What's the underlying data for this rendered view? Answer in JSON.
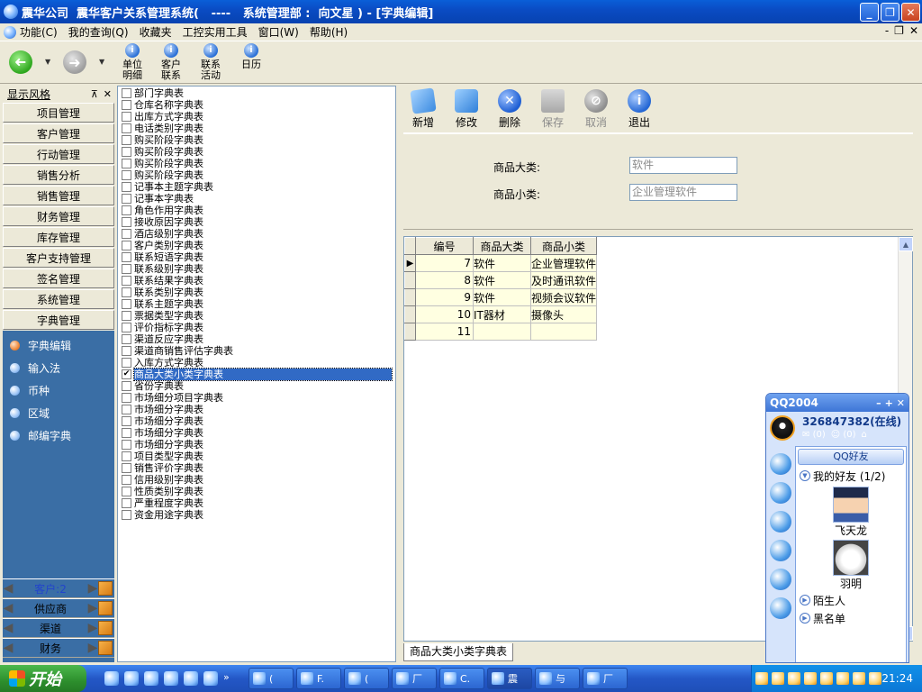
{
  "window": {
    "title": "震华公司  震华客户关系管理系统(   ----   系统管理部 :  向文星 ) - [字典编辑]",
    "minimize": "_",
    "restore": "❐",
    "close": "✕"
  },
  "menu": {
    "items": [
      "功能(C)",
      "我的查询(Q)",
      "收藏夹",
      "工控实用工具",
      "窗口(W)",
      "帮助(H)"
    ],
    "mdi_controls": [
      "-",
      "❐",
      "✕"
    ]
  },
  "toolbar": {
    "back_arrow": "➜",
    "fwd_arrow": "➜",
    "dropdown": "▼",
    "buttons": [
      {
        "label": "单位\n明细",
        "icon": "info-icon"
      },
      {
        "label": "客户\n联系",
        "icon": "info-icon"
      },
      {
        "label": "联系\n活动",
        "icon": "info-icon"
      },
      {
        "label": "日历",
        "icon": "info-icon"
      }
    ],
    "icon_glyph": "i"
  },
  "left_panel": {
    "title": "显示风格",
    "pin": "⊼",
    "close": "✕",
    "modules": [
      "项目管理",
      "客户管理",
      "行动管理",
      "销售分析",
      "销售管理",
      "财务管理",
      "库存管理",
      "客户支持管理",
      "签名管理",
      "系统管理",
      "字典管理"
    ],
    "sub_items": [
      "字典编辑",
      "输入法",
      "币种",
      "区域",
      "邮编字典"
    ],
    "active_sub": 0,
    "bottom": [
      "客户:2",
      "供应商",
      "渠道",
      "财务"
    ],
    "left_arrow": "◀",
    "right_arrow": "▶"
  },
  "dict_list": {
    "items": [
      "部门字典表",
      "仓库名称字典表",
      "出库方式字典表",
      "电话类别字典表",
      "购买阶段字典表",
      "购买阶段字典表",
      "购买阶段字典表",
      "购买阶段字典表",
      "记事本主题字典表",
      "记事本字典表",
      "角色作用字典表",
      "接收原因字典表",
      "酒店级别字典表",
      "客户类别字典表",
      "联系短语字典表",
      "联系级别字典表",
      "联系结果字典表",
      "联系类别字典表",
      "联系主题字典表",
      "票据类型字典表",
      "评价指标字典表",
      "渠道反应字典表",
      "渠道商销售评估字典表",
      "入库方式字典表",
      "商品大类小类字典表",
      "省份字典表",
      "市场细分项目字典表",
      "市场细分字典表",
      "市场细分字典表",
      "市场细分字典表",
      "市场细分字典表",
      "项目类型字典表",
      "销售评价字典表",
      "信用级别字典表",
      "性质类别字典表",
      "严重程度字典表",
      "资金用途字典表"
    ],
    "selected_index": 24,
    "check_mark": "✔"
  },
  "actions": {
    "new": "新增",
    "edit": "修改",
    "delete": "删除",
    "save": "保存",
    "cancel": "取消",
    "exit": "退出",
    "delete_glyph": "✕",
    "cancel_glyph": "⊘",
    "exit_glyph": "i"
  },
  "form": {
    "category_label": "商品大类:",
    "category_value": "软件",
    "subcategory_label": "商品小类:",
    "subcategory_value": "企业管理软件"
  },
  "grid": {
    "columns": [
      "编号",
      "商品大类",
      "商品小类"
    ],
    "current_row_marker": "▶",
    "rows": [
      {
        "id": "7",
        "category": "软件",
        "sub": "企业管理软件"
      },
      {
        "id": "8",
        "category": "软件",
        "sub": "及时通讯软件"
      },
      {
        "id": "9",
        "category": "软件",
        "sub": "视频会议软件"
      },
      {
        "id": "10",
        "category": "IT器材",
        "sub": "摄像头"
      },
      {
        "id": "11",
        "category": "",
        "sub": ""
      }
    ],
    "scroll_up": "▲",
    "scroll_down": "▼"
  },
  "bottom_tab": "商品大类小类字典表",
  "qq": {
    "title": "QQ2004",
    "controls": [
      "–",
      "+",
      "✕"
    ],
    "number": "326847382(在线)",
    "mail": "(0)",
    "contacts": "(0)",
    "friends_tab": "QQ好友",
    "my_friends": "我的好友 (1/2)",
    "friends": [
      "飞天龙",
      "羽明"
    ],
    "strangers": "陌生人",
    "blacklist": "黑名单",
    "expanded_glyph": "▼",
    "collapsed_glyph": "▶"
  },
  "taskbar": {
    "start": "开始",
    "tasks": [
      "(",
      "F.",
      "(",
      "厂",
      "C.",
      "震",
      "与",
      "厂"
    ],
    "active_task": 5,
    "more": "»",
    "clock": "21:24"
  },
  "colors": {
    "title_bar": "#0a4cc4",
    "left_list_bg": "#3a6ea5",
    "selection": "#316ac5",
    "grid_cell": "#ffffe1"
  }
}
